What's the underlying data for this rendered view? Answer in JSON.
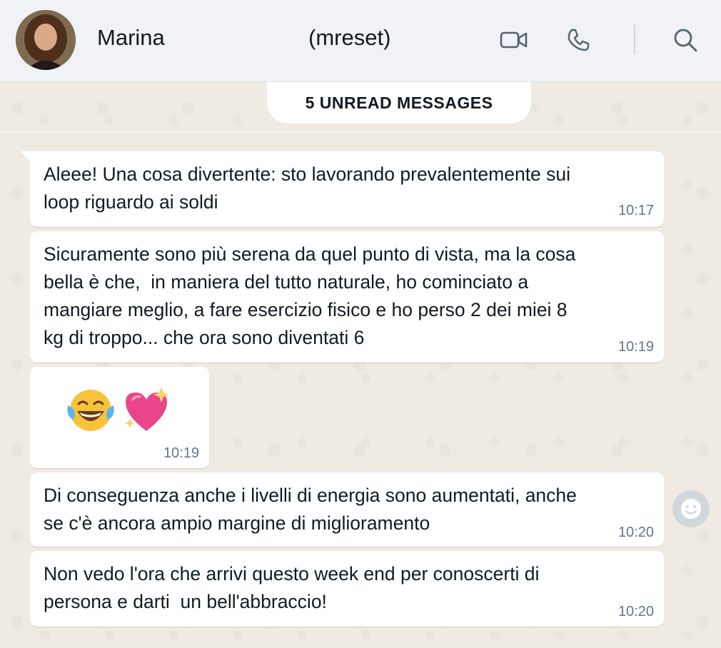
{
  "header": {
    "contact_name": "Marina",
    "contact_handle": "(mreset)",
    "icons": [
      "video-call-icon",
      "voice-call-icon",
      "search-icon"
    ]
  },
  "chat": {
    "unread_banner": "5 UNREAD MESSAGES",
    "messages": [
      {
        "text": "Aleee! Una cosa divertente: sto lavorando prevalentemente sui\nloop riguardo ai soldi",
        "time": "10:17"
      },
      {
        "text": "Sicuramente sono più serena da quel punto di vista, ma la cosa\nbella è che,  in maniera del tutto naturale, ho cominciato a\nmangiare meglio, a fare esercizio fisico e ho perso 2 dei miei 8\nkg di troppo... che ora sono diventati 6",
        "time": "10:19"
      },
      {
        "emojis": [
          "face-with-tears-of-joy",
          "sparkling-heart"
        ],
        "time": "10:19"
      },
      {
        "text": "Di conseguenza anche i livelli di energia sono aumentati, anche\nse c'è ancora ampio margine di miglioramento",
        "time": "10:20"
      },
      {
        "text": "Non vedo l'ora che arrivi questo week end per conoscerti di\npersona e darti  un bell'abbraccio!",
        "time": "10:20"
      }
    ]
  },
  "colors": {
    "header_bg": "#f0f2f5",
    "chat_bg": "#efeae2",
    "bubble_bg": "#ffffff",
    "time_text": "#667781",
    "icon_gray": "#54656f"
  }
}
